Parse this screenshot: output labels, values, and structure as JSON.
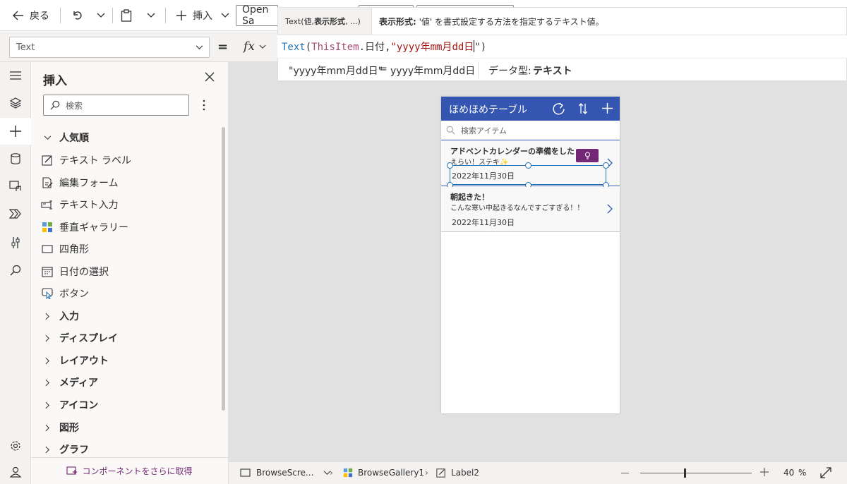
{
  "toolbar": {
    "back_label": "戻る",
    "insert_label": "挿入",
    "font_value": "Open Sa"
  },
  "property": {
    "selected": "Text",
    "equals": "=",
    "fx_label": "fx"
  },
  "tooltip": {
    "signature_prefix": "Text(値, ",
    "signature_bold": "表示形式",
    "signature_suffix": ", ...)",
    "param_bold": "表示形式:",
    "param_desc": " '値' を書式設定する方法を指定するテキスト値。"
  },
  "formula": {
    "fn": "Text",
    "open": "(",
    "obj": "ThisItem",
    "dot_field": ".日付,",
    "str": "\"yyyy年mm月dd日",
    "close": "\")"
  },
  "result": {
    "expression": "\"yyyy年mm月dd日\"",
    "eq": "=",
    "value": "yyyy年mm月dd日",
    "type_label": "データ型:",
    "type_value": "テキスト"
  },
  "insert_pane": {
    "title": "挿入",
    "search_placeholder": "検索",
    "popular_label": "人気順",
    "items": [
      {
        "label": "テキスト ラベル",
        "icon": "text-label-icon"
      },
      {
        "label": "編集フォーム",
        "icon": "edit-form-icon"
      },
      {
        "label": "テキスト入力",
        "icon": "text-input-icon"
      },
      {
        "label": "垂直ギャラリー",
        "icon": "vertical-gallery-icon"
      },
      {
        "label": "四角形",
        "icon": "rectangle-icon"
      },
      {
        "label": "日付の選択",
        "icon": "date-picker-icon"
      },
      {
        "label": "ボタン",
        "icon": "button-icon"
      }
    ],
    "categories": [
      "入力",
      "ディスプレイ",
      "レイアウト",
      "メディア",
      "アイコン",
      "図形",
      "グラフ"
    ],
    "get_more_label": "コンポーネントをさらに取得"
  },
  "phone": {
    "header_title": "ほめほめテーブル",
    "search_placeholder": "検索アイテム",
    "items": [
      {
        "title": "アドベントカレンダーの準備をした",
        "subtitle": "えらい！ステキ✨",
        "date": "2022年11月30日"
      },
      {
        "title": "朝起きた！",
        "subtitle": "こんな寒い中起きるなんですごすぎる！！",
        "date": "2022年11月30日"
      }
    ]
  },
  "statusbar": {
    "screen_label": "BrowseScre...",
    "gallery_label": "BrowseGallery1",
    "label_label": "Label2",
    "zoom_value": "40",
    "zoom_unit": "%",
    "zoom_level": 0.4
  },
  "colors": {
    "header_blue": "#3456b1",
    "accent_purple": "#742774",
    "selection_blue": "#1f6fb5"
  }
}
